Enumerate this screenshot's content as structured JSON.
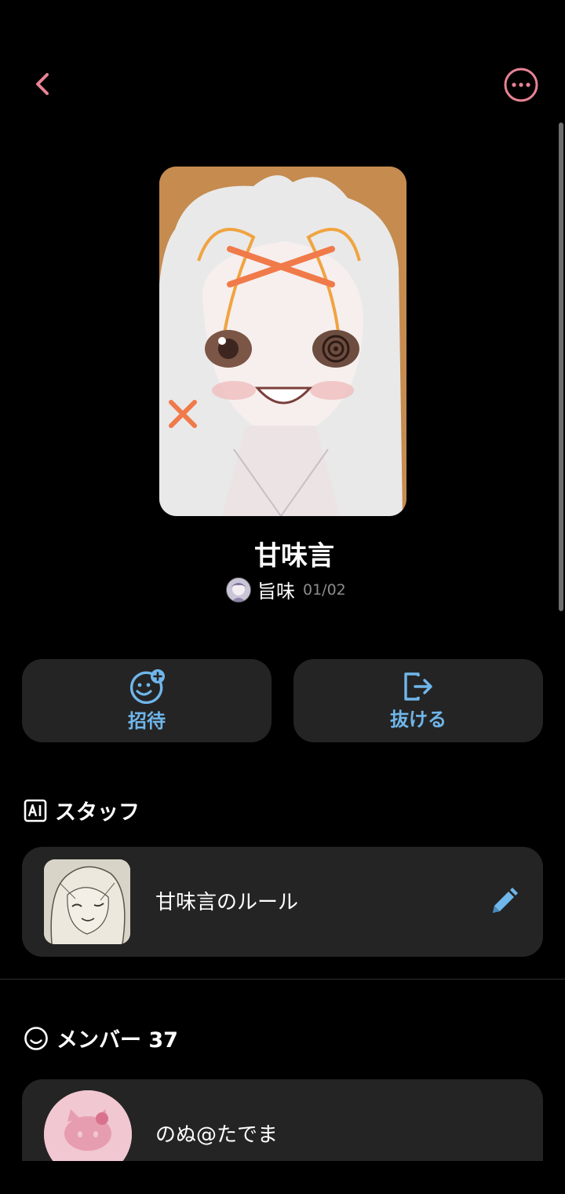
{
  "header": {
    "back_icon": "chevron-left-icon",
    "more_icon": "more-horizontal-circle-icon",
    "accent": "#e88394"
  },
  "group": {
    "title": "甘味言",
    "owner_name": "旨味",
    "owner_date": "01/02"
  },
  "actions": {
    "invite_label": "招待",
    "leave_label": "抜ける",
    "accent": "#6fb6ea"
  },
  "staff": {
    "section_title": "スタッフ",
    "section_icon": "ai-badge-icon",
    "items": [
      {
        "label": "甘味言のルール",
        "action_icon": "pencil-icon"
      }
    ]
  },
  "members": {
    "section_title": "メンバー 37",
    "section_icon": "smiley-icon",
    "items": [
      {
        "name": "のぬ@たでま"
      }
    ]
  }
}
